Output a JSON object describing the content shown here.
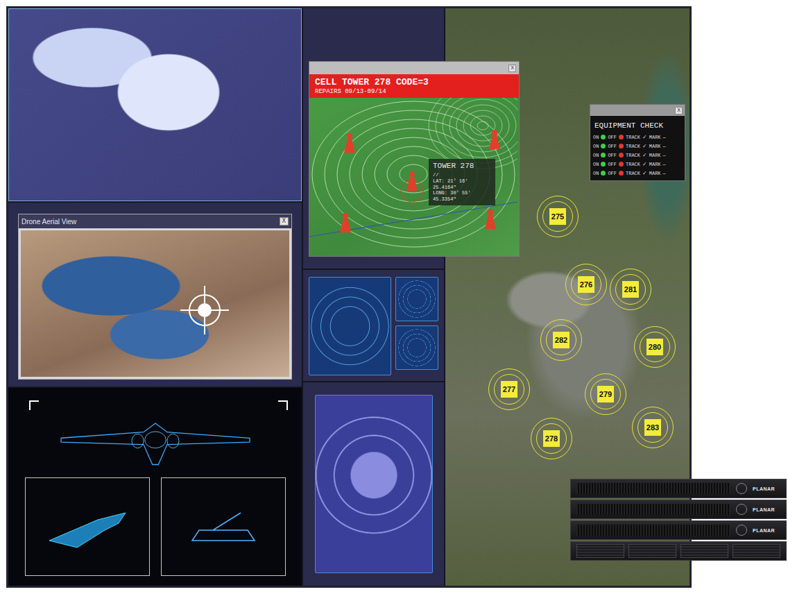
{
  "drone_window": {
    "title": "Drone Aerial View",
    "close": "X"
  },
  "cell_tower_window": {
    "title": "CELL TOWER 278 CODE=3",
    "subtitle": "REPAIRS 09/13-09/14",
    "close": "X",
    "popup": {
      "title": "TOWER 278",
      "lines": [
        "//",
        "LAT: 21° 16'",
        "25.4164\"",
        "LONG: 30° 55'",
        "45.3354\""
      ]
    }
  },
  "equipment_check": {
    "title": "EQUIPMENT CHECK",
    "close": "X",
    "rows": [
      {
        "on_label": "ON",
        "off_label": "OFF",
        "track": "TRACK",
        "mark_icon": "✓",
        "mark": "MARK",
        "dash": "—"
      },
      {
        "on_label": "ON",
        "off_label": "OFF",
        "track": "TRACK",
        "mark_icon": "✓",
        "mark": "MARK",
        "dash": "—"
      },
      {
        "on_label": "ON",
        "off_label": "OFF",
        "track": "TRACK",
        "mark_icon": "✓",
        "mark": "MARK",
        "dash": "—"
      },
      {
        "on_label": "ON",
        "off_label": "OFF",
        "track": "TRACK",
        "mark_icon": "✓",
        "mark": "MARK",
        "dash": "—"
      },
      {
        "on_label": "ON",
        "off_label": "OFF",
        "track": "TRACK",
        "mark_icon": "✓",
        "mark": "MARK",
        "dash": "—"
      }
    ]
  },
  "map_markers": [
    {
      "label": "275"
    },
    {
      "label": "276"
    },
    {
      "label": "281"
    },
    {
      "label": "282"
    },
    {
      "label": "280"
    },
    {
      "label": "277"
    },
    {
      "label": "279"
    },
    {
      "label": "278"
    },
    {
      "label": "283"
    }
  ],
  "rack": {
    "units": [
      {
        "kind": "controller",
        "brand": "PLANAR"
      },
      {
        "kind": "controller",
        "brand": "PLANAR"
      },
      {
        "kind": "controller",
        "brand": "PLANAR"
      },
      {
        "kind": "power"
      }
    ]
  }
}
